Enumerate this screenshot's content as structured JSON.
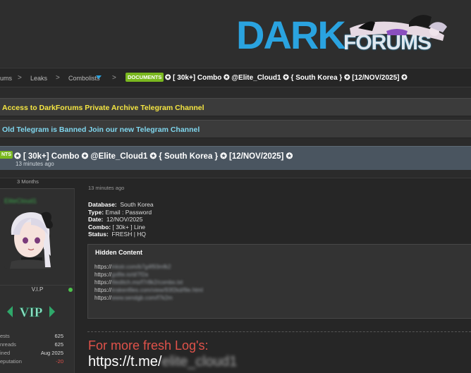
{
  "header": {
    "logo_main": "DARK",
    "logo_sub": "FORUMS"
  },
  "breadcrumb": {
    "items": [
      "ums",
      "Leaks",
      "Combolists"
    ],
    "separator": ">",
    "badge": "DOCUMENTS",
    "title": "✪ [ 30k+] Combo ✪ @Elite_Cloud1 ✪ { South Korea } ✪ [12/NOV/2025] ✪"
  },
  "announcements": [
    {
      "text": "Access to DarkForums Private Archive Telegram Channel"
    },
    {
      "text": "Old Telegram is Banned Join our new Telegram Channel"
    }
  ],
  "thread": {
    "badge": "NTS",
    "title": "✪ [ 30k+] Combo ✪ @Elite_Cloud1 ✪ { South Korea } ✪ [12/NOV/2025] ✪",
    "time": "13 minutes ago"
  },
  "author": {
    "username": "EliteCloud1",
    "rank": "V.I.P",
    "rank_badge": "VIP",
    "online_color": "#4cc24c",
    "stats": [
      {
        "label": "Posts",
        "display_label": "ests",
        "value": "625"
      },
      {
        "label": "Threads",
        "display_label": "nreads",
        "value": "625"
      },
      {
        "label": "Joined",
        "display_label": "ined",
        "value": "Aug 2025"
      },
      {
        "label": "Reputation",
        "display_label": "eputation",
        "value": "-20"
      }
    ],
    "membership": "3 Months"
  },
  "post": {
    "time": "13 minutes ago",
    "details": [
      {
        "label": "Database:",
        "value": "South Korea"
      },
      {
        "label": "Type:",
        "value": "Email : Password"
      },
      {
        "label": "Date:",
        "value": "12/NOV/2025"
      },
      {
        "label": "Combo:",
        "value": "[ 30k+ ]  Line"
      },
      {
        "label": "Status:",
        "value": "FRESH | HQ"
      }
    ],
    "hidden_title": "Hidden Content",
    "links": [
      {
        "prefix": "https://",
        "blurred": "lnkstr.com/b7g4f93mfk2"
      },
      {
        "prefix": "https://",
        "blurred": "gofile.io/d/7f2a"
      },
      {
        "prefix": "https://",
        "blurred": "fileditch.ms/f7r8k2/combo.txt"
      },
      {
        "prefix": "https://",
        "blurred": "krakenfiles.com/view/93f2kd/file.html"
      },
      {
        "prefix": "https://",
        "blurred": "www.sendgb.com/f7k2m"
      }
    ],
    "promo": "For more fresh Log's:",
    "promo_link_prefix": "https://t.me/",
    "promo_link_blurred": "elite_cloud1"
  },
  "colors": {
    "accent_blue": "#2aa3e0",
    "badge_green": "#7ab81f",
    "announce_yellow": "#f5e642",
    "announce_cyan": "#7fd6ee",
    "promo_red": "#e0524a"
  }
}
